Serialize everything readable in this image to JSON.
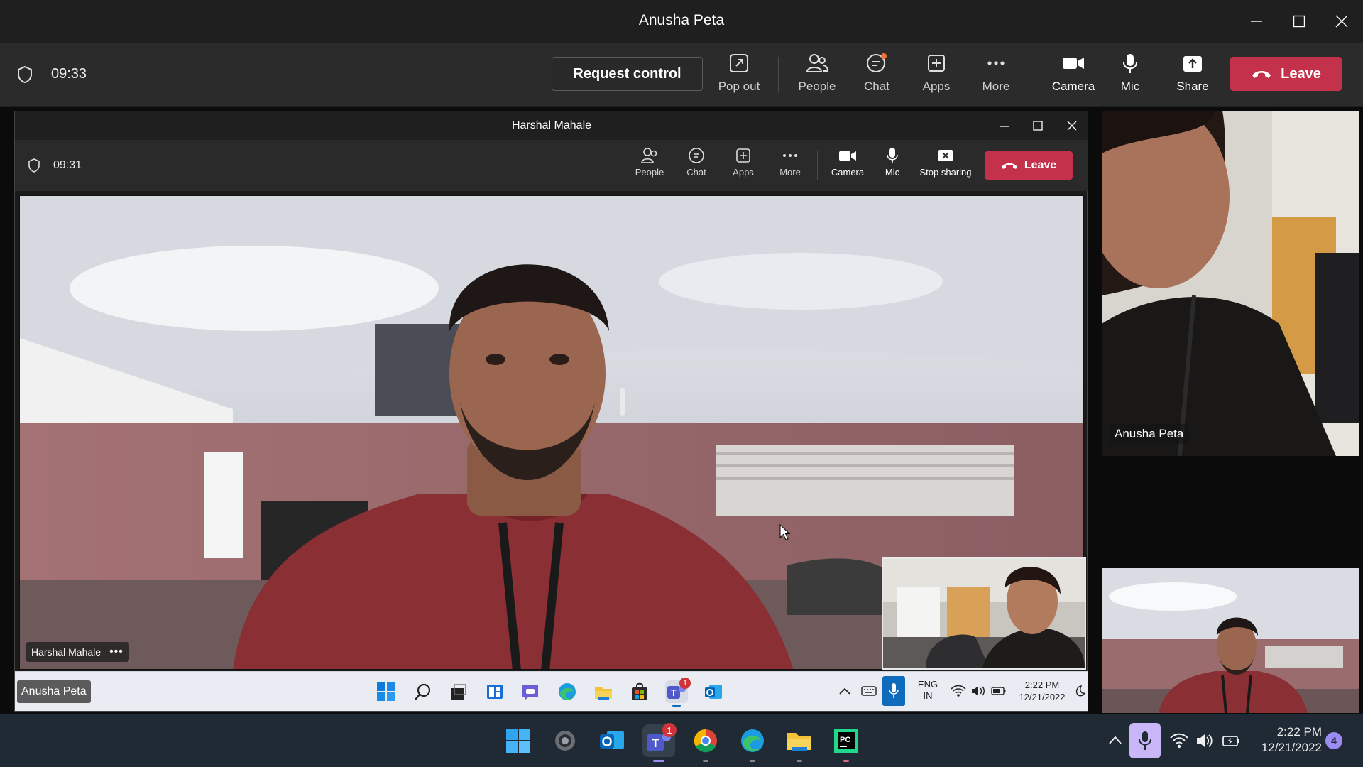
{
  "window": {
    "title": "Anusha Peta"
  },
  "outer_toolbar": {
    "timer": "09:33",
    "request_control": "Request control",
    "pop_out": "Pop out",
    "people": "People",
    "chat": "Chat",
    "apps": "Apps",
    "more": "More",
    "camera": "Camera",
    "mic": "Mic",
    "share": "Share",
    "leave": "Leave"
  },
  "shared_window": {
    "title": "Harshal Mahale",
    "timer": "09:31",
    "people": "People",
    "chat": "Chat",
    "apps": "Apps",
    "more": "More",
    "camera": "Camera",
    "mic": "Mic",
    "stop_sharing": "Stop sharing",
    "leave": "Leave",
    "main_participant": "Harshal Mahale",
    "taskbar": {
      "lang": "ENG",
      "region": "IN",
      "time": "2:22 PM",
      "date": "12/21/2022",
      "teams_badge": "1"
    }
  },
  "presenter_label": "Anusha Peta",
  "right_panel": {
    "participant_name": "Anusha Peta"
  },
  "taskbar": {
    "time": "2:22 PM",
    "date": "12/21/2022",
    "teams_badge": "1",
    "notification_count": "4"
  },
  "colors": {
    "leave": "#c4314b",
    "accent": "#9b8cf5",
    "mic_active": "#c9b6f7"
  }
}
